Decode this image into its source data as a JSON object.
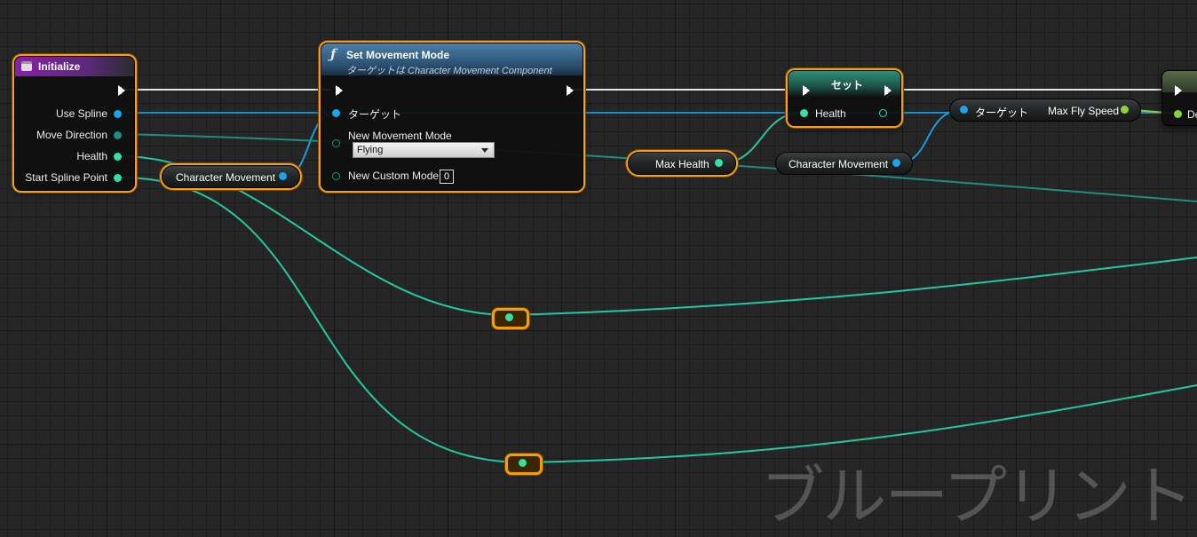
{
  "colors": {
    "exec": "#ffffff",
    "object_pin": "#1aa6ea",
    "float_pin": "#34e0a8",
    "struct_pin": "#1c8f80",
    "selection": "#f3a01c",
    "wire_float": "#22c8a0",
    "wire_object": "#1a9ee0"
  },
  "nodes": {
    "initialize": {
      "title": "Initialize",
      "icon": "event-icon",
      "pins": {
        "use_spline": "Use Spline",
        "move_direction": "Move Direction",
        "health": "Health",
        "start_spline_point": "Start Spline Point"
      }
    },
    "character_movement_1": {
      "label": "Character Movement"
    },
    "set_movement_mode": {
      "title": "Set Movement Mode",
      "subtitle": "ターゲットは Character Movement Component",
      "icon": "function-icon",
      "pins": {
        "target": "ターゲット",
        "new_movement_mode": "New Movement Mode",
        "new_movement_mode_value": "Flying",
        "new_custom_mode": "New Custom Mode",
        "new_custom_mode_value": "0"
      }
    },
    "max_health": {
      "label": "Max Health"
    },
    "set_health": {
      "title": "セット",
      "pins": {
        "health": "Health"
      }
    },
    "character_movement_2": {
      "label": "Character Movement"
    },
    "max_fly_speed_getter": {
      "target_label": "ターゲット",
      "output_label": "Max Fly Speed"
    },
    "next_node": {
      "pin_label": "De"
    }
  },
  "watermark": "ブループリント"
}
